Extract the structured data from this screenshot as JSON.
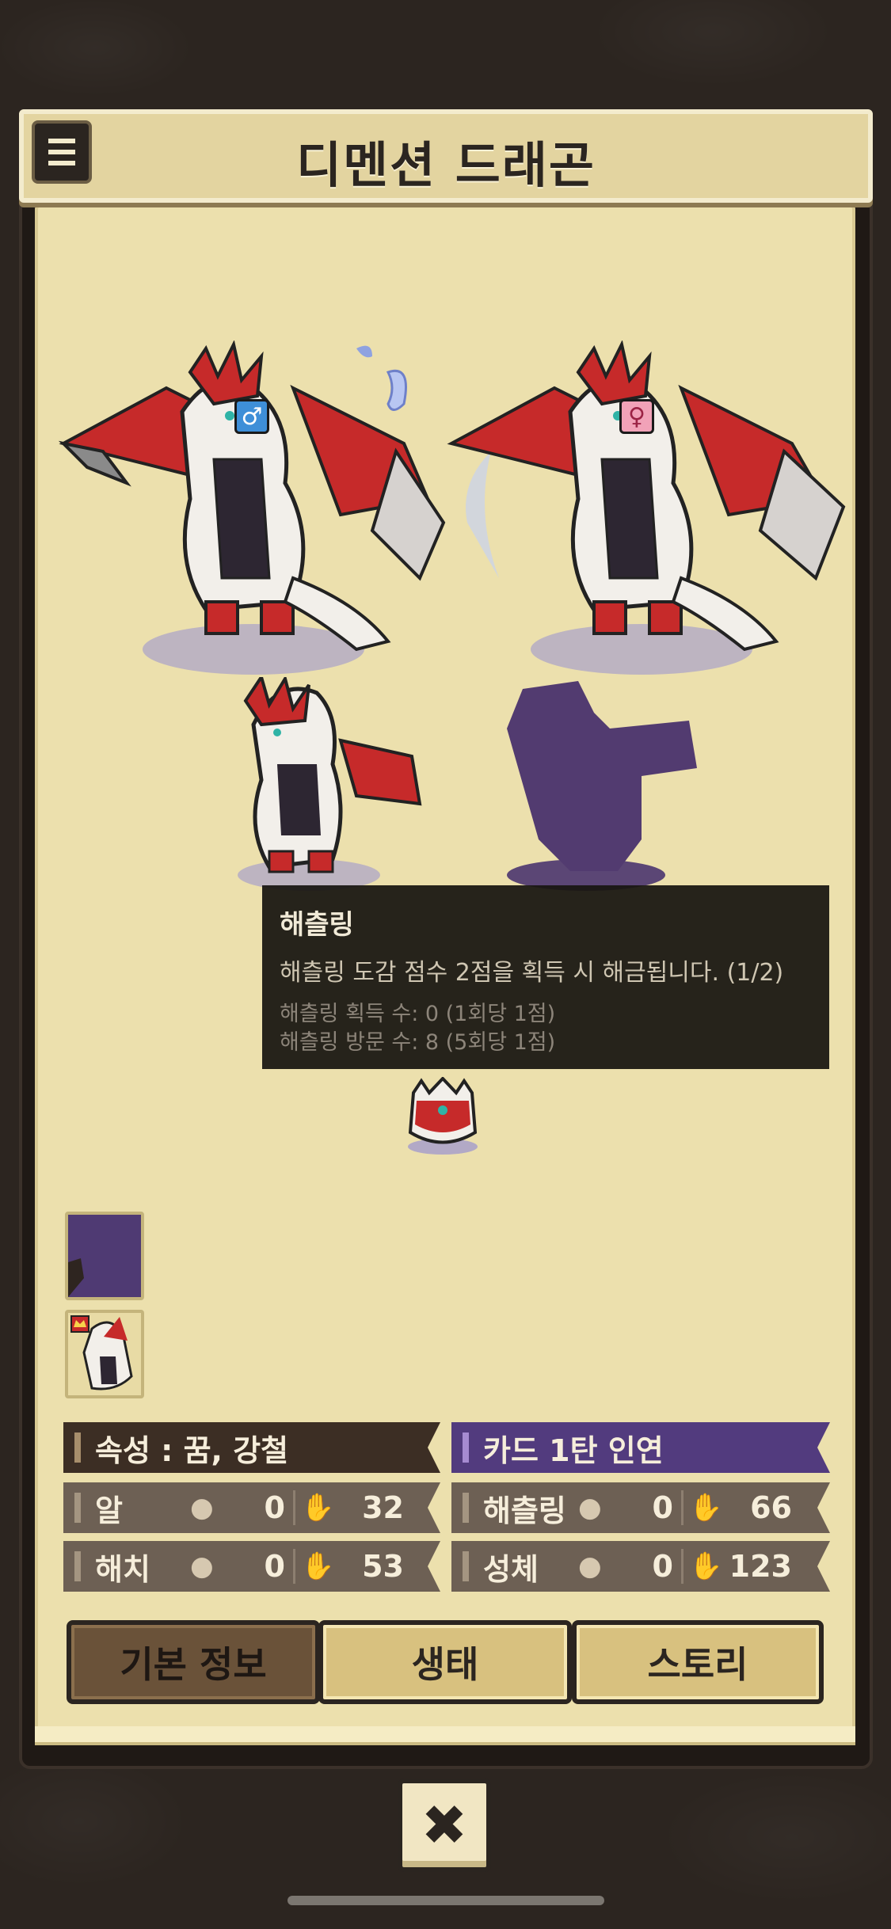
{
  "header": {
    "title": "디멘션 드래곤"
  },
  "tooltip": {
    "title": "해츨링",
    "description": "해츨링 도감 점수 2점을 획득 시 해금됩니다. (1/2)",
    "line1": "해츨링 획득 수: 0 (1회당 1점)",
    "line2": "해츨링 방문 수: 8 (5회당 1점)"
  },
  "stats": {
    "attribute_label": "속성 : 꿈, 강철",
    "card_label": "카드 1탄 인연",
    "rows": [
      {
        "label": "알",
        "eggs": "0",
        "hands": "32"
      },
      {
        "label": "해치",
        "eggs": "0",
        "hands": "53"
      },
      {
        "label": "해츨링",
        "eggs": "0",
        "hands": "66"
      },
      {
        "label": "성체",
        "eggs": "0",
        "hands": "123"
      }
    ]
  },
  "tabs": [
    {
      "label": "기본 정보",
      "active": true
    },
    {
      "label": "생태",
      "active": false
    },
    {
      "label": "스토리",
      "active": false
    }
  ],
  "icons": {
    "male": "♂",
    "female": "♀",
    "close": "✖"
  },
  "colors": {
    "accent_purple": "#523b7e",
    "header_bg": "#e3d4a0",
    "content_bg": "#ece0ad"
  }
}
